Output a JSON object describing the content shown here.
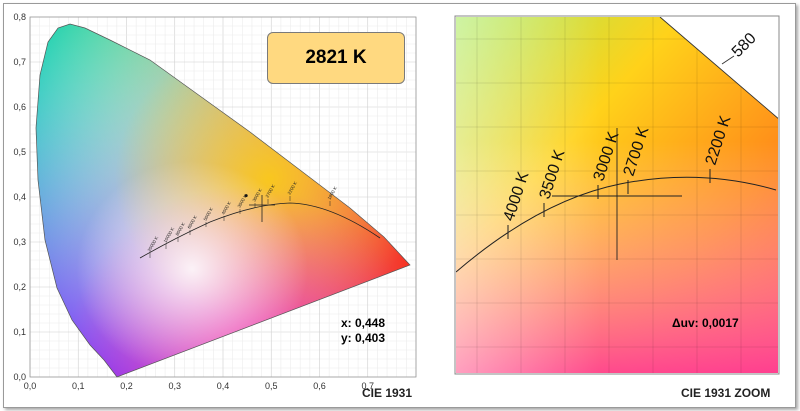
{
  "cct_readout": "2821 K",
  "coords": {
    "x_label": "x: 0,448",
    "y_label": "y: 0,403"
  },
  "duv_label": "Δuv: 0,0017",
  "chart_data": [
    {
      "type": "scatter",
      "title": "",
      "caption": "CIE 1931",
      "xlim": [
        0,
        0.8
      ],
      "ylim": [
        0,
        0.8
      ],
      "x_ticks": [
        "0,0",
        "0,1",
        "0,2",
        "0,3",
        "0,4",
        "0,5",
        "0,6",
        "0,7"
      ],
      "y_ticks": [
        "0,0",
        "0,1",
        "0,2",
        "0,3",
        "0,4",
        "0,5",
        "0,6",
        "0,7",
        "0,8"
      ],
      "grid": true,
      "locus_labels": [
        "1800 K",
        "2200 K",
        "2700 K",
        "3000 K",
        "3500 K",
        "4000 K",
        "5000 K",
        "6500 K",
        "8000 K",
        "10000 K",
        "20000 K"
      ],
      "series": [
        {
          "values": [
            {
              "x": 0.448,
              "y": 0.403
            }
          ]
        }
      ]
    },
    {
      "type": "scatter",
      "caption": "CIE 1931 ZOOM",
      "locus_labels": [
        "4000 K",
        "3500 K",
        "3000 K",
        "2700 K",
        "2200 K"
      ],
      "spectral_label": "580",
      "series": [
        {
          "values": [
            {
              "x": 0.448,
              "y": 0.403
            }
          ]
        }
      ]
    }
  ]
}
